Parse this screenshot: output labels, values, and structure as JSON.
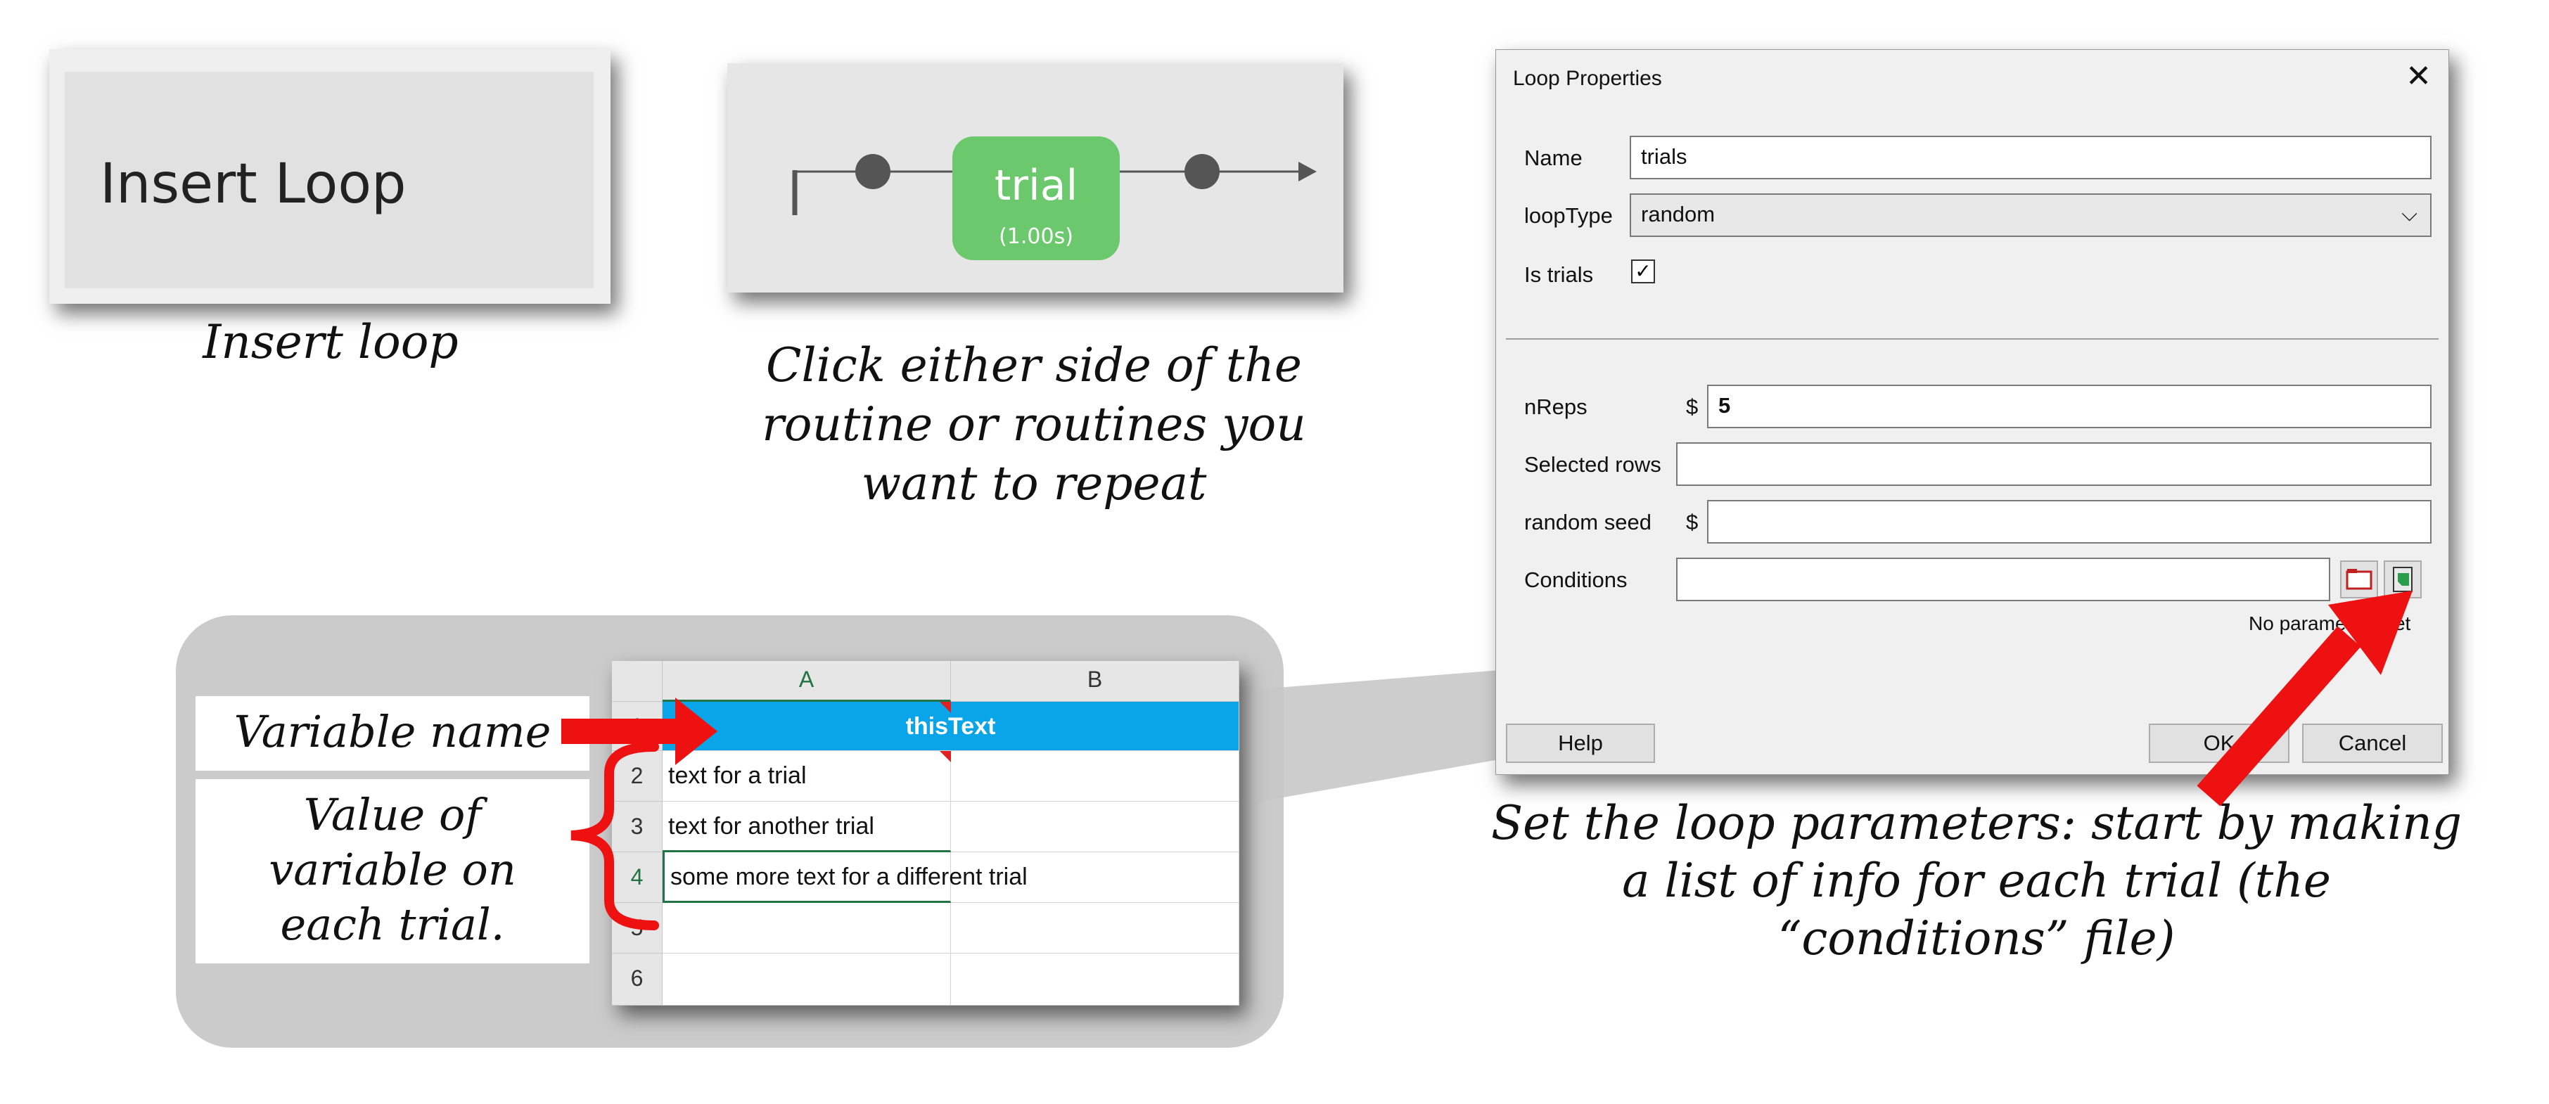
{
  "insert_panel": {
    "button_label": "Insert Loop",
    "caption": "Insert loop"
  },
  "flow_panel": {
    "routine_name": "trial",
    "routine_duration": "(1.00s)",
    "routine_color": "#6cc86c",
    "caption_lines": [
      "Click either side of the",
      "routine or routines you",
      "want to repeat"
    ]
  },
  "dialog": {
    "title": "Loop Properties",
    "close_icon": "close-icon",
    "fields": {
      "name": {
        "label": "Name",
        "value": "trials"
      },
      "loop_type": {
        "label": "loopType",
        "value": "random"
      },
      "is_trials": {
        "label": "Is trials",
        "checked": true
      },
      "n_reps": {
        "label": "nReps",
        "value": "5",
        "prefix": "$"
      },
      "selected_rows": {
        "label": "Selected rows",
        "value": ""
      },
      "random_seed": {
        "label": "random seed",
        "value": "",
        "prefix": "$"
      },
      "conditions": {
        "label": "Conditions",
        "value": ""
      }
    },
    "status_text": "No parameters set",
    "buttons": {
      "help": "Help",
      "ok": "OK",
      "cancel": "Cancel"
    },
    "caption_lines": [
      "Set the loop parameters: start by making",
      "a list of info for each trial (the",
      "“conditions” file)"
    ]
  },
  "sheet_panel": {
    "variable_name_label": "Variable name",
    "value_label_lines": [
      "Value of",
      "variable on",
      "each trial."
    ],
    "columns": [
      "A",
      "B"
    ],
    "rows": [
      {
        "num": "1",
        "a": "thisText",
        "b": ""
      },
      {
        "num": "2",
        "a": "text for a trial",
        "b": ""
      },
      {
        "num": "3",
        "a": "text for another trial",
        "b": ""
      },
      {
        "num": "4",
        "a": "some more text for a different trial",
        "b": ""
      },
      {
        "num": "5",
        "a": "",
        "b": ""
      },
      {
        "num": "6",
        "a": "",
        "b": ""
      }
    ],
    "header_row_color": "#0aa4e8",
    "arrow_color": "#ee1111"
  }
}
